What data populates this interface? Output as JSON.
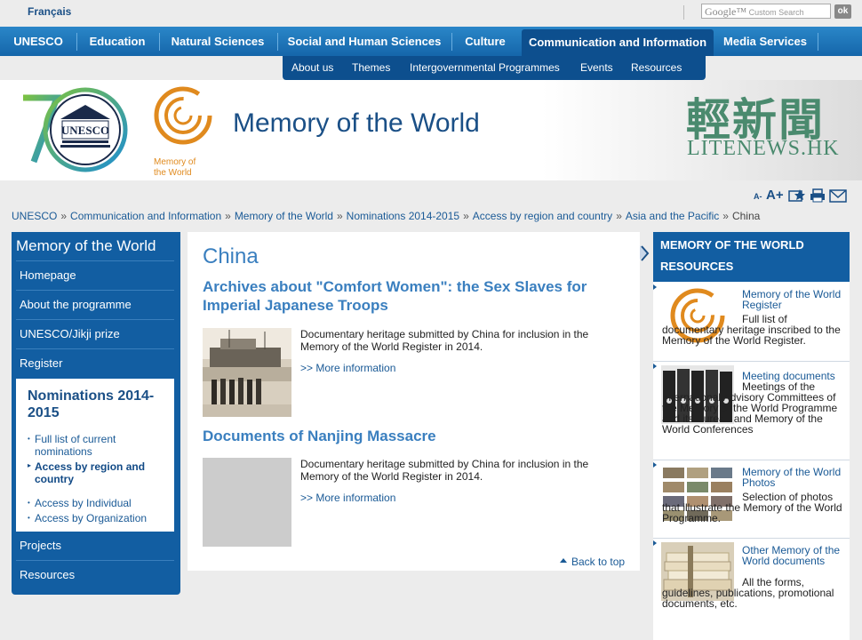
{
  "top": {
    "language_link": "Français",
    "search_placeholder_brand": "Google™",
    "search_placeholder": "Custom Search",
    "search_button": "ok"
  },
  "main_nav": [
    {
      "label": "UNESCO"
    },
    {
      "label": "Education"
    },
    {
      "label": "Natural Sciences"
    },
    {
      "label": "Social and Human Sciences"
    },
    {
      "label": "Culture"
    },
    {
      "label": "Communication and Information"
    },
    {
      "label": "Media Services"
    }
  ],
  "sub_nav": [
    {
      "label": "About us"
    },
    {
      "label": "Themes"
    },
    {
      "label": "Intergovernmental Programmes"
    },
    {
      "label": "Events"
    },
    {
      "label": "Resources"
    }
  ],
  "banner": {
    "title": "Memory of the World",
    "logo_caption_1": "Memory of",
    "logo_caption_2": "the World",
    "unesco_logo_text": "UNESCO",
    "watermark_chinese": "輕新聞",
    "watermark_latin": "LITENEWS.HK",
    "accent_orange": "#e08a1e",
    "accent_blue": "#1a4f86"
  },
  "tools": {
    "font_smaller": "A-",
    "font_larger": "A+"
  },
  "breadcrumb": [
    "UNESCO",
    "Communication and Information",
    "Memory of the World",
    "Nominations 2014-2015",
    "Access by region and country",
    "Asia and the Pacific",
    "China"
  ],
  "left_nav": {
    "title": "Memory of the World",
    "items": [
      "Homepage",
      "About the programme",
      "UNESCO/Jikji prize",
      "Register"
    ],
    "section_title": "Nominations 2014-2015",
    "sub_items": [
      "Full list of current nominations",
      "Access by region and country",
      "Access by Individual",
      "Access by Organization"
    ],
    "bottom_items": [
      "Projects",
      "Resources"
    ]
  },
  "content": {
    "page_title": "China",
    "entries": [
      {
        "title": "Archives about \"Comfort Women\": the Sex Slaves for Imperial Japanese Troops",
        "description": "Documentary heritage submitted by China for inclusion in the Memory of the World Register in 2014.",
        "more": ">> More information"
      },
      {
        "title": "Documents of Nanjing Massacre",
        "description": "Documentary heritage submitted by China for inclusion in the Memory of the World Register in 2014.",
        "more": ">> More information"
      }
    ],
    "back_to_top": "Back to top"
  },
  "resources": {
    "heading": "MEMORY OF THE WORLD RESOURCES",
    "items": [
      {
        "link": "Memory of the World Register",
        "text": "Full list of documentary heritage inscribed to the Memory of the World Register."
      },
      {
        "link": "Meeting documents",
        "text": "Meetings of the International Advisory Committees of the Memory of the World Programme and its Bureau and Memory of the World Conferences"
      },
      {
        "link": "Memory of the World Photos",
        "text": "Selection of photos that illustrate the Memory of the World Programme."
      },
      {
        "link": "Other Memory of the World documents",
        "text": "All the forms, guidelines, publications, promotional documents, etc."
      }
    ]
  }
}
